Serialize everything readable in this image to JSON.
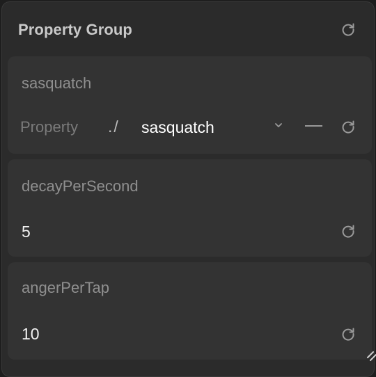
{
  "panel": {
    "title": "Property Group"
  },
  "properties": [
    {
      "name": "sasquatch",
      "row_label": "Property",
      "path_prefix": "./",
      "selected_value": "sasquatch"
    },
    {
      "name": "decayPerSecond",
      "value": "5"
    },
    {
      "name": "angerPerTap",
      "value": "10"
    }
  ],
  "icons": {
    "reset": "reset-icon",
    "chevron": "chevron-down-icon",
    "remove": "minus-icon",
    "resize": "resize-handle-icon"
  },
  "colors": {
    "panel_bg": "#2b2b2b",
    "card_bg": "#333333",
    "label": "#8f8f8f",
    "value": "#f2f2f2",
    "icon": "#9a9a9a"
  }
}
